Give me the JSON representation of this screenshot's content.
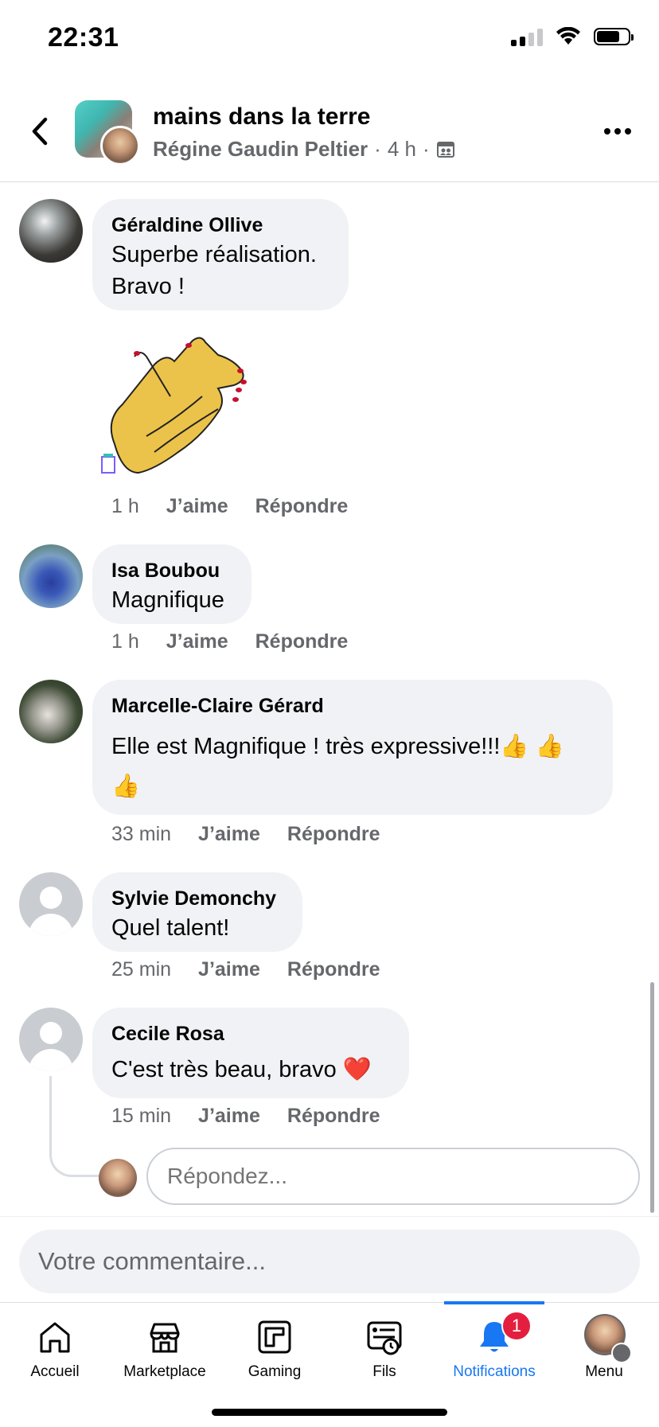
{
  "status": {
    "time": "22:31"
  },
  "header": {
    "group_name": "mains dans la terre",
    "author": "Régine Gaudin Peltier",
    "separator": "·",
    "age": "4 h"
  },
  "comments": [
    {
      "name": "Géraldine Ollive",
      "text_line1": "Superbe réalisation.",
      "text_line2": "Bravo !",
      "time": "1 h",
      "like": "J’aime",
      "reply": "Répondre"
    },
    {
      "name": "Isa Boubou",
      "text": "Magnifique",
      "time": "1 h",
      "like": "J’aime",
      "reply": "Répondre"
    },
    {
      "name": "Marcelle-Claire Gérard",
      "text_line1": "Elle est Magnifique ! très expressive!!!👍 👍",
      "text_line2": "👍",
      "time": "33 min",
      "like": "J’aime",
      "reply": "Répondre"
    },
    {
      "name": "Sylvie Demonchy",
      "text": "Quel talent!",
      "time": "25 min",
      "like": "J’aime",
      "reply": "Répondre"
    },
    {
      "name": "Cecile Rosa",
      "text": "C'est très beau, bravo ❤️",
      "time": "15 min",
      "like": "J’aime",
      "reply": "Répondre"
    }
  ],
  "reply_box": {
    "placeholder": "Répondez..."
  },
  "composer": {
    "placeholder": "Votre commentaire..."
  },
  "tabs": [
    {
      "label": "Accueil",
      "icon": "home-icon"
    },
    {
      "label": "Marketplace",
      "icon": "marketplace-icon"
    },
    {
      "label": "Gaming",
      "icon": "gaming-icon"
    },
    {
      "label": "Fils",
      "icon": "feeds-icon"
    },
    {
      "label": "Notifications",
      "icon": "bell-icon",
      "badge": "1",
      "active": true
    },
    {
      "label": "Menu",
      "icon": "menu-avatar"
    }
  ],
  "colors": {
    "accent": "#1877f2",
    "badge": "#e41e3f",
    "bubble": "#f0f2f5",
    "secondary_text": "#65676b"
  }
}
